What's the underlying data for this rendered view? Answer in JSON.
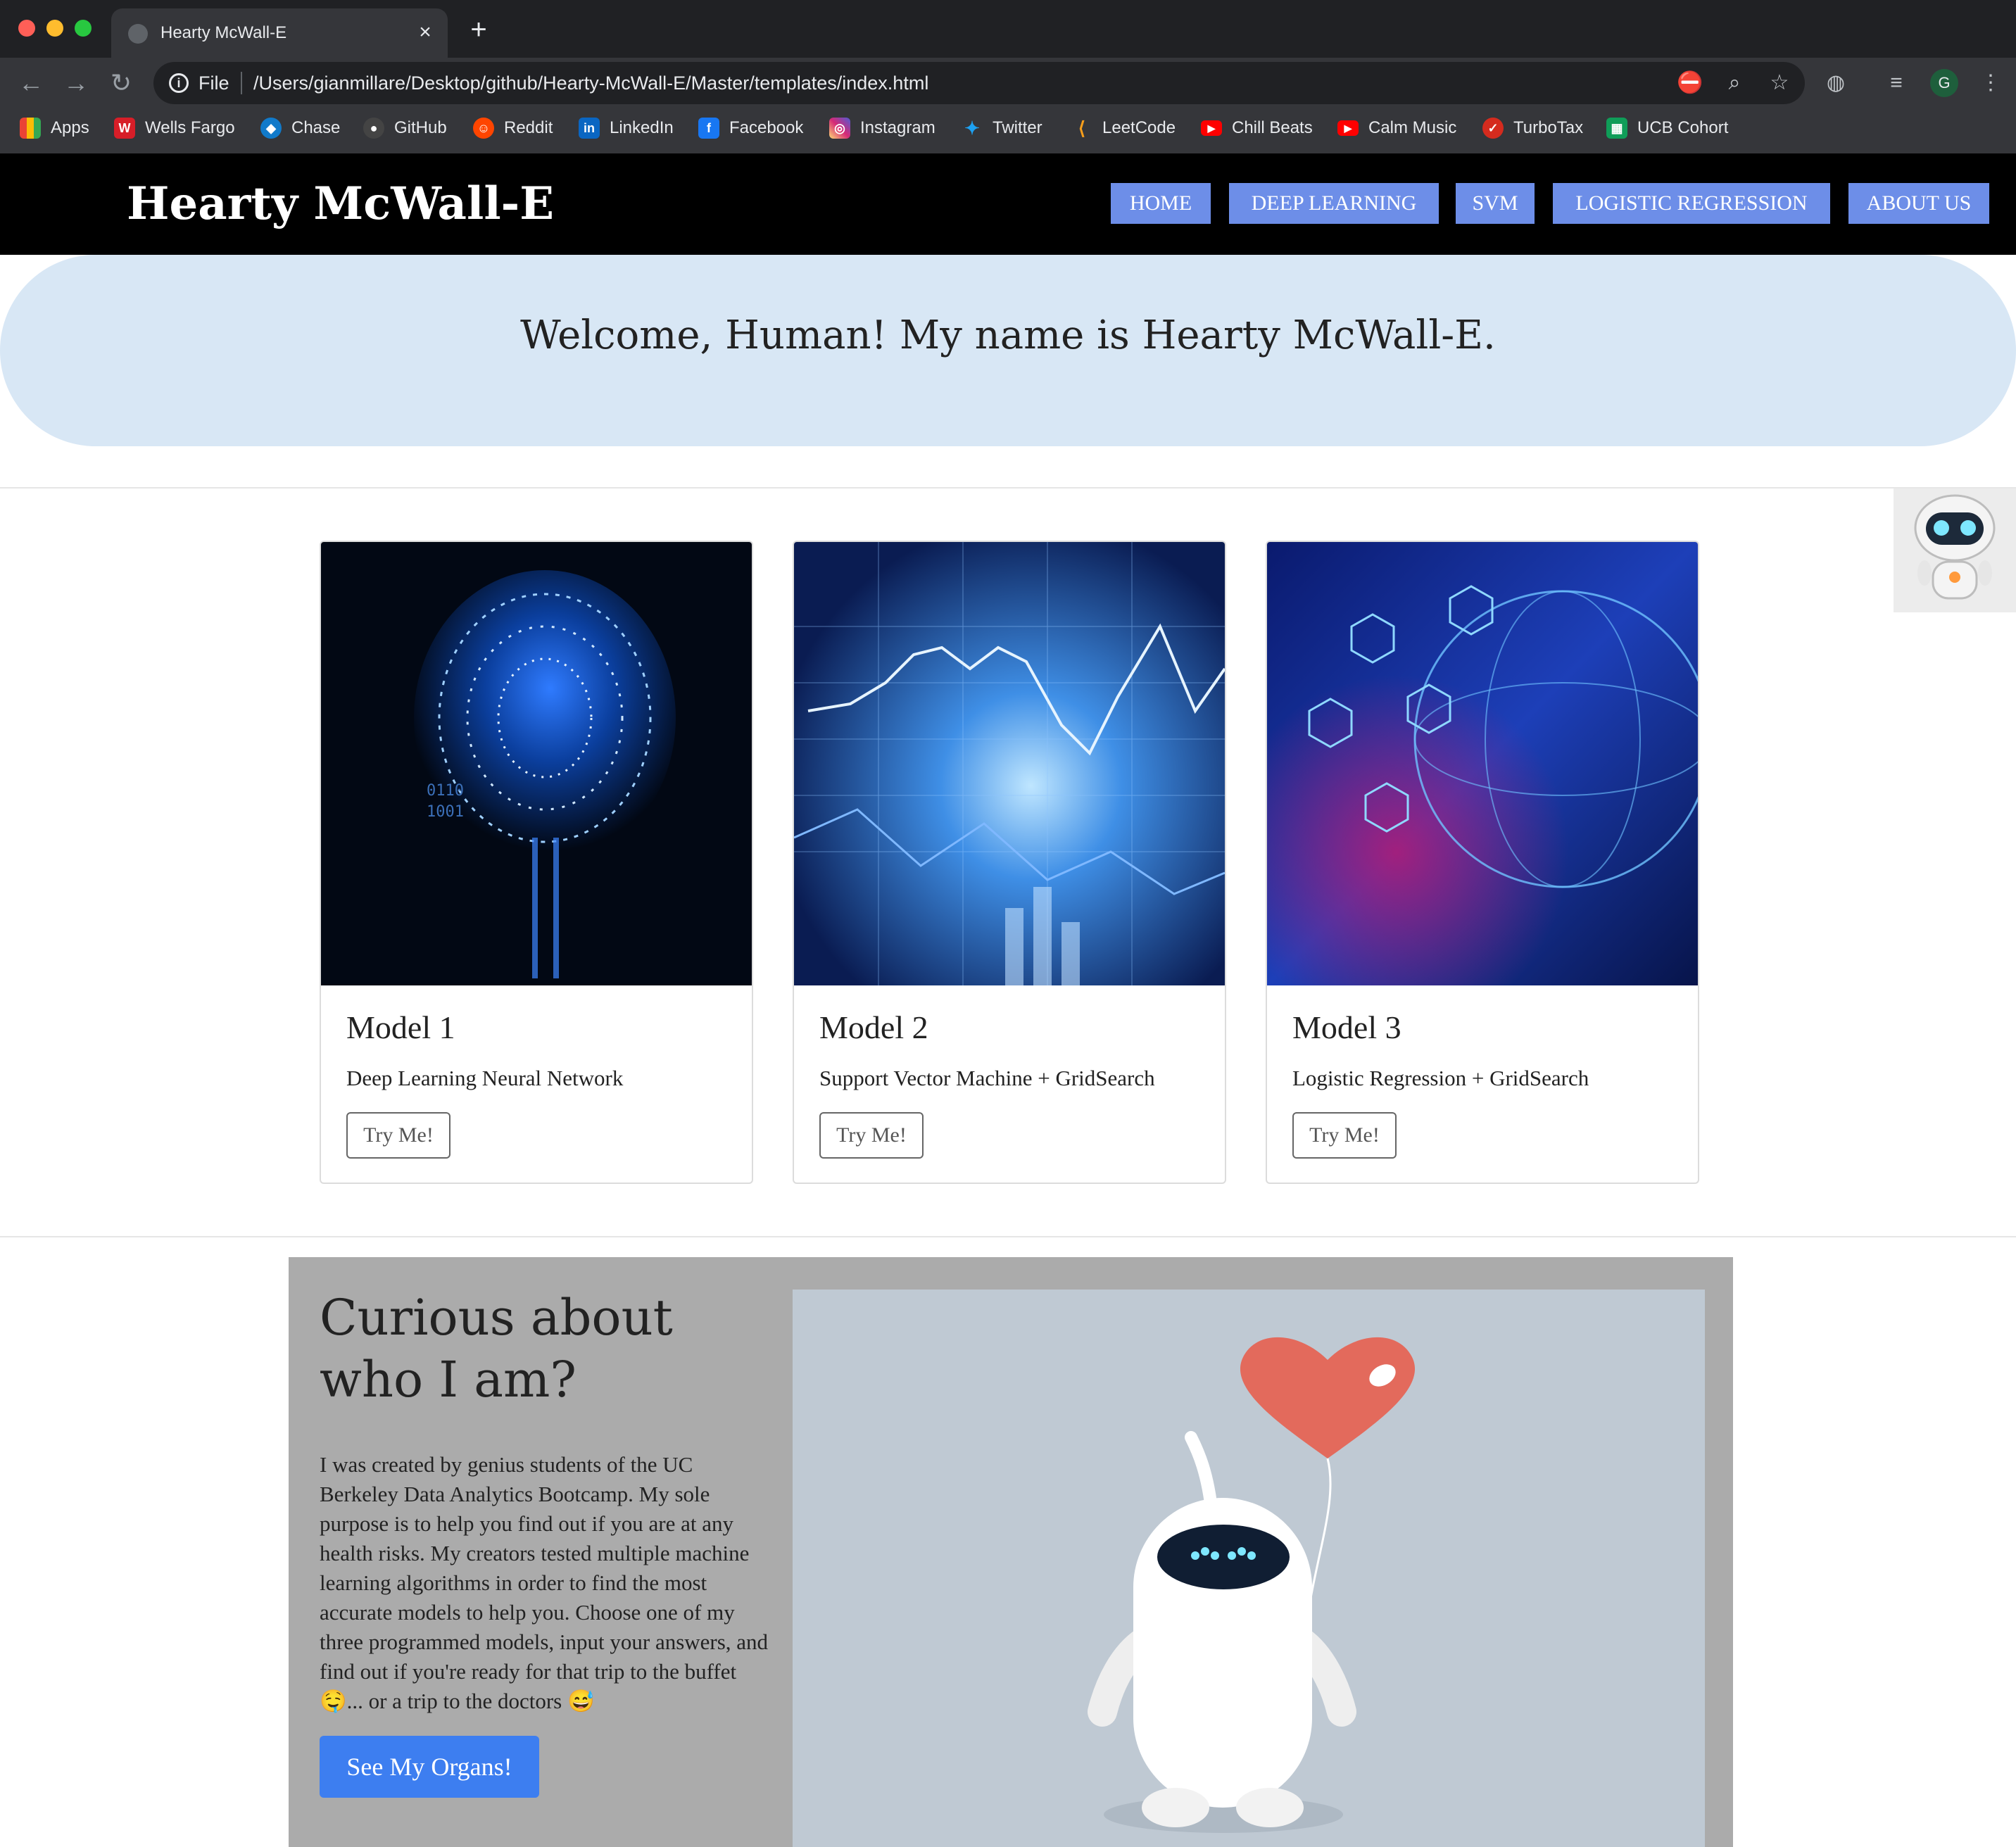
{
  "browser": {
    "tab_title": "Hearty McWall-E",
    "scheme_label": "File",
    "url": "/Users/gianmillare/Desktop/github/Hearty-McWall-E/Master/templates/index.html",
    "profile_initial": "G",
    "bookmarks": [
      {
        "label": "Apps",
        "icon": "apps-grid-icon",
        "color": "#4285f4"
      },
      {
        "label": "Wells Fargo",
        "icon": "wells-fargo-icon",
        "color": "#d71e28"
      },
      {
        "label": "Chase",
        "icon": "chase-icon",
        "color": "#117aca"
      },
      {
        "label": "GitHub",
        "icon": "github-icon",
        "color": "#444444"
      },
      {
        "label": "Reddit",
        "icon": "reddit-icon",
        "color": "#ff4500"
      },
      {
        "label": "LinkedIn",
        "icon": "linkedin-icon",
        "color": "#0a66c2"
      },
      {
        "label": "Facebook",
        "icon": "facebook-icon",
        "color": "#1877f2"
      },
      {
        "label": "Instagram",
        "icon": "instagram-icon",
        "color": "#c13584"
      },
      {
        "label": "Twitter",
        "icon": "twitter-icon",
        "color": "#1da1f2"
      },
      {
        "label": "LeetCode",
        "icon": "leetcode-icon",
        "color": "#f89f1b"
      },
      {
        "label": "Chill Beats",
        "icon": "youtube-icon",
        "color": "#ff0000"
      },
      {
        "label": "Calm Music",
        "icon": "youtube-icon",
        "color": "#ff0000"
      },
      {
        "label": "TurboTax",
        "icon": "turbotax-icon",
        "color": "#d52b1e"
      },
      {
        "label": "UCB Cohort",
        "icon": "google-sheets-icon",
        "color": "#0f9d58"
      }
    ]
  },
  "site": {
    "brand": "Hearty McWall-E",
    "nav": [
      "HOME",
      "DEEP LEARNING",
      "SVM",
      "LOGISTIC REGRESSION",
      "ABOUT US"
    ],
    "nav_color": "#6d8ee8",
    "hero_title": "Welcome, Human! My name is Hearty McWall-E.",
    "hero_color": "#d8e7f5"
  },
  "models": [
    {
      "title": "Model 1",
      "description": "Deep Learning Neural Network",
      "button": "Try Me!",
      "image": "circuit-brain-image"
    },
    {
      "title": "Model 2",
      "description": "Support Vector Machine + GridSearch",
      "button": "Try Me!",
      "image": "financial-chart-image"
    },
    {
      "title": "Model 3",
      "description": "Logistic Regression + GridSearch",
      "button": "Try Me!",
      "image": "digital-globe-image"
    }
  ],
  "about": {
    "title": "Curious about who I am?",
    "text": "I was created by genius students of the UC Berkeley Data Analytics Bootcamp. My sole purpose is to help you find out if you are at any health risks. My creators tested multiple machine learning algorithms in order to find the most accurate models to help you. Choose one of my three programmed models, input your answers, and find out if you're ready for that trip to the buffet 🤤... or a trip to the doctors 😅",
    "button": "See My Organs!",
    "button_color": "#3d7ef0",
    "image": "robot-with-heart-balloon-image"
  }
}
